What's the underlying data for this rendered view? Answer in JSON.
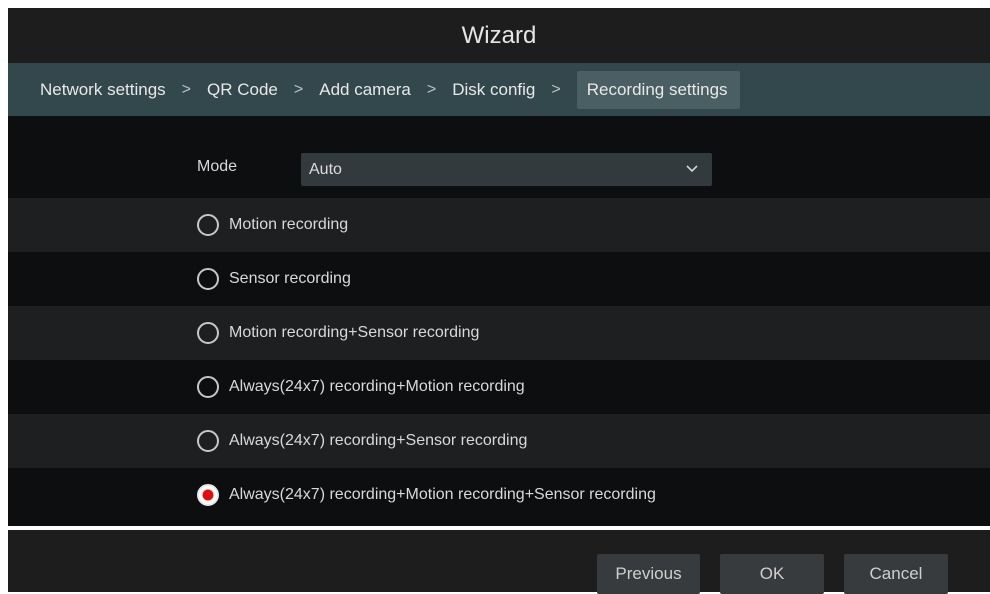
{
  "window": {
    "title": "Wizard"
  },
  "steps": [
    {
      "label": "Network settings"
    },
    {
      "label": "QR Code"
    },
    {
      "label": "Add camera"
    },
    {
      "label": "Disk config"
    },
    {
      "label": "Recording settings",
      "active": true
    }
  ],
  "step_separator": ">",
  "mode": {
    "label": "Mode",
    "value": "Auto"
  },
  "options": [
    {
      "label": "Motion recording",
      "selected": false
    },
    {
      "label": "Sensor recording",
      "selected": false
    },
    {
      "label": "Motion recording+Sensor recording",
      "selected": false
    },
    {
      "label": "Always(24x7) recording+Motion recording",
      "selected": false
    },
    {
      "label": "Always(24x7) recording+Sensor recording",
      "selected": false
    },
    {
      "label": "Always(24x7) recording+Motion recording+Sensor recording",
      "selected": true
    }
  ],
  "buttons": {
    "previous": "Previous",
    "ok": "OK",
    "cancel": "Cancel"
  },
  "colors": {
    "accent_selected": "#e00b0b",
    "header_bar": "#33484d"
  },
  "icons": {
    "dropdown": "chevron-down-icon",
    "step_separator": "chevron-right-icon"
  }
}
